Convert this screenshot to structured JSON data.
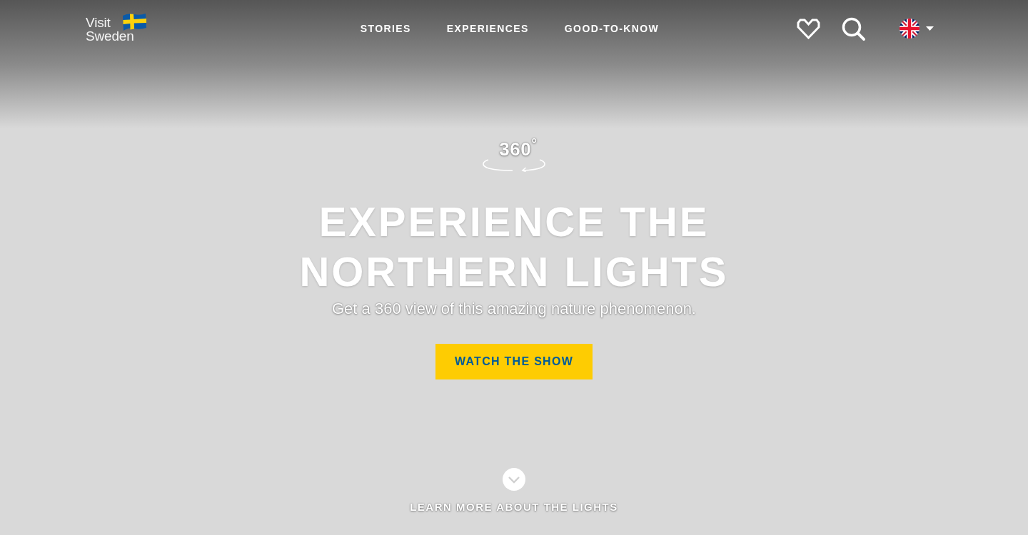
{
  "header": {
    "logo": {
      "line_1": "Visit",
      "line_2": "Sweden"
    },
    "nav": [
      {
        "label": "STORIES"
      },
      {
        "label": "EXPERIENCES"
      },
      {
        "label": "GOOD-TO-KNOW"
      }
    ]
  },
  "hero": {
    "badge": "360$^{°}$",
    "title": "EXPERIENCE THE NORTHERN LIGHTS",
    "subtitle": "Get a 360 view of this amazing nature phenomenon.",
    "button": "WATCH THE SHOW",
    "scroll_link": "LEARN MORE ABOUT THE LIGHTS"
  }
}
